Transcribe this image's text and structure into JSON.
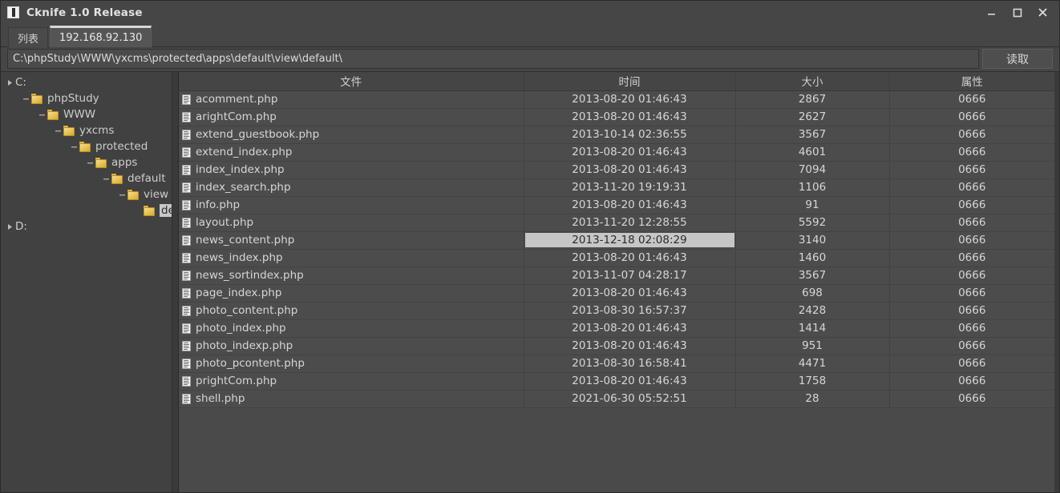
{
  "window": {
    "title": "Cknife 1.0 Release",
    "app_icon": "app-icon",
    "minimize_label": "—",
    "maximize_label": "□",
    "close_label": "✕"
  },
  "tabs": [
    {
      "label": "列表",
      "active": false
    },
    {
      "label": "192.168.92.130",
      "active": true
    }
  ],
  "pathbar": {
    "value": "C:\\phpStudy\\WWW\\yxcms\\protected\\apps\\default\\view\\default\\",
    "placeholder": "",
    "read_button": "读取"
  },
  "tree": [
    {
      "label": "C:",
      "depth": 0,
      "marker": "arrow",
      "icon": "none",
      "selected": false
    },
    {
      "label": "phpStudy",
      "depth": 1,
      "marker": "dash",
      "icon": "folder",
      "selected": false
    },
    {
      "label": "WWW",
      "depth": 2,
      "marker": "dash",
      "icon": "folder",
      "selected": false
    },
    {
      "label": "yxcms",
      "depth": 3,
      "marker": "dash",
      "icon": "folder",
      "selected": false
    },
    {
      "label": "protected",
      "depth": 4,
      "marker": "dash",
      "icon": "folder",
      "selected": false
    },
    {
      "label": "apps",
      "depth": 5,
      "marker": "dash",
      "icon": "folder",
      "selected": false
    },
    {
      "label": "default",
      "depth": 6,
      "marker": "dash",
      "icon": "folder",
      "selected": false
    },
    {
      "label": "view",
      "depth": 7,
      "marker": "dash",
      "icon": "folder",
      "selected": false
    },
    {
      "label": "default",
      "depth": 8,
      "marker": "none",
      "icon": "folder",
      "selected": true
    },
    {
      "label": "D:",
      "depth": 0,
      "marker": "arrow",
      "icon": "none",
      "selected": false
    }
  ],
  "table": {
    "columns": [
      "文件",
      "时间",
      "大小",
      "属性"
    ],
    "selected_row": 8,
    "selected_column": 1,
    "rows": [
      {
        "file": "acomment.php",
        "time": "2013-08-20 01:46:43",
        "size": "2867",
        "attr": "0666"
      },
      {
        "file": "arightCom.php",
        "time": "2013-08-20 01:46:43",
        "size": "2627",
        "attr": "0666"
      },
      {
        "file": "extend_guestbook.php",
        "time": "2013-10-14 02:36:55",
        "size": "3567",
        "attr": "0666"
      },
      {
        "file": "extend_index.php",
        "time": "2013-08-20 01:46:43",
        "size": "4601",
        "attr": "0666"
      },
      {
        "file": "index_index.php",
        "time": "2013-08-20 01:46:43",
        "size": "7094",
        "attr": "0666"
      },
      {
        "file": "index_search.php",
        "time": "2013-11-20 19:19:31",
        "size": "1106",
        "attr": "0666"
      },
      {
        "file": "info.php",
        "time": "2013-08-20 01:46:43",
        "size": "91",
        "attr": "0666"
      },
      {
        "file": "layout.php",
        "time": "2013-11-20 12:28:55",
        "size": "5592",
        "attr": "0666"
      },
      {
        "file": "news_content.php",
        "time": "2013-12-18 02:08:29",
        "size": "3140",
        "attr": "0666"
      },
      {
        "file": "news_index.php",
        "time": "2013-08-20 01:46:43",
        "size": "1460",
        "attr": "0666"
      },
      {
        "file": "news_sortindex.php",
        "time": "2013-11-07 04:28:17",
        "size": "3567",
        "attr": "0666"
      },
      {
        "file": "page_index.php",
        "time": "2013-08-20 01:46:43",
        "size": "698",
        "attr": "0666"
      },
      {
        "file": "photo_content.php",
        "time": "2013-08-30 16:57:37",
        "size": "2428",
        "attr": "0666"
      },
      {
        "file": "photo_index.php",
        "time": "2013-08-20 01:46:43",
        "size": "1414",
        "attr": "0666"
      },
      {
        "file": "photo_indexp.php",
        "time": "2013-08-20 01:46:43",
        "size": "951",
        "attr": "0666"
      },
      {
        "file": "photo_pcontent.php",
        "time": "2013-08-30 16:58:41",
        "size": "4471",
        "attr": "0666"
      },
      {
        "file": "prightCom.php",
        "time": "2013-08-20 01:46:43",
        "size": "1758",
        "attr": "0666"
      },
      {
        "file": "shell.php",
        "time": "2021-06-30 05:52:51",
        "size": "28",
        "attr": "0666"
      }
    ]
  },
  "colors": {
    "window_bg": "#464646",
    "panel_bg": "#414141",
    "row_bg": "#4c4c4c",
    "text": "#d6d6d6",
    "selection": "#c6c6c6",
    "folder": "#ecc65c"
  }
}
